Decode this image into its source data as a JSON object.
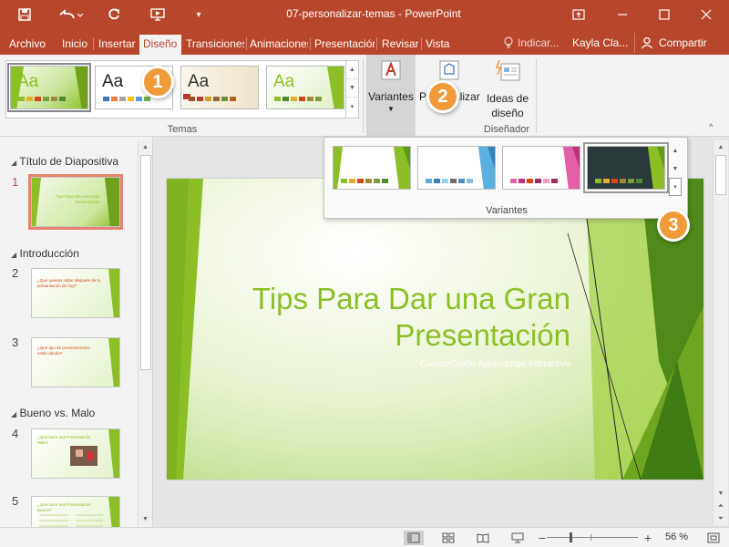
{
  "window": {
    "title": "07-personalizar-temas  -  PowerPoint"
  },
  "tabs": [
    {
      "label": "Archivo"
    },
    {
      "label": "Inicio"
    },
    {
      "label": "Insertar"
    },
    {
      "label": "Diseño"
    },
    {
      "label": "Transiciones"
    },
    {
      "label": "Animaciones"
    },
    {
      "label": "Presentación"
    },
    {
      "label": "Revisar"
    },
    {
      "label": "Vista"
    }
  ],
  "active_tab": "Diseño",
  "tell_me": "Indicar...",
  "user_name": "Kayla Cla...",
  "share_label": "Compartir",
  "ribbon": {
    "themes_group_label": "Temas",
    "theme_thumb_text": "Aa",
    "variants_label": "Variantes",
    "customize_label": "Personalizar",
    "design_ideas_line1": "Ideas de",
    "design_ideas_line2": "diseño",
    "designer_group_label": "Diseñador"
  },
  "variants_popup": {
    "label": "Variantes"
  },
  "callouts": {
    "one": "1",
    "two": "2",
    "three": "3"
  },
  "sections": [
    {
      "title": "Título de Diapositiva"
    },
    {
      "title": "Introducción"
    },
    {
      "title": "Bueno vs. Malo"
    }
  ],
  "slides": [
    {
      "num": "1",
      "text": "Tips Para Dar una Gran Presentación"
    },
    {
      "num": "2",
      "text": "¿Qué quieres saber después de tu presentación de hoy?"
    },
    {
      "num": "3",
      "text": "¿Qué tipo de presentaciones están dando?"
    },
    {
      "num": "4",
      "text": "¿Qué hace una Presentación Mala?"
    },
    {
      "num": "5",
      "text": "¿Qué hace una Presentación Buena?"
    }
  ],
  "main_slide": {
    "title_line1": "Tips Para Dar una Gran",
    "title_line2": "Presentación",
    "subtitle": "CustomGuide Aprendizaje Interactivo"
  },
  "status": {
    "zoom": "56 %",
    "zoom_percent": 56
  },
  "colors": {
    "accent": "#b7472a",
    "theme_green": "#8cbf26",
    "callout_orange": "#f09a3a"
  }
}
